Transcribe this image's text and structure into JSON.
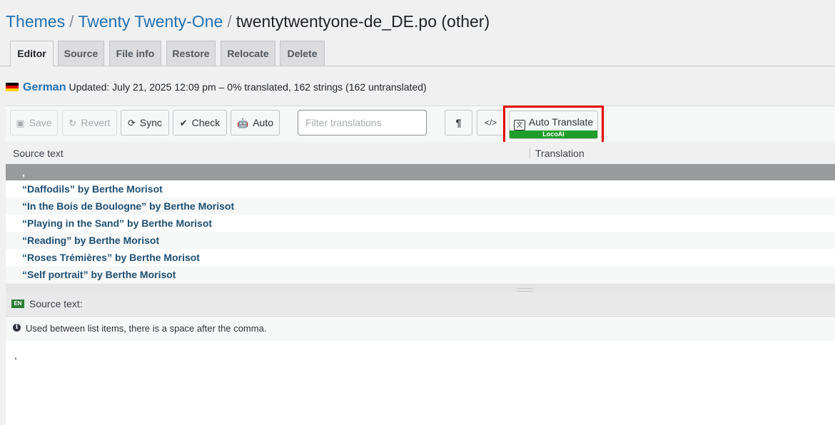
{
  "breadcrumb": {
    "themes": "Themes",
    "theme": "Twenty Twenty-One",
    "file": "twentytwentyone-de_DE.po (other)",
    "separator": "/"
  },
  "tabs": [
    "Editor",
    "Source",
    "File info",
    "Restore",
    "Relocate",
    "Delete"
  ],
  "language": {
    "name": "German",
    "status": "Updated: July 21, 2025 12:09 pm – 0% translated, 162 strings (162 untranslated)"
  },
  "toolbar": {
    "save": "Save",
    "revert": "Revert",
    "sync": "Sync",
    "check": "Check",
    "auto": "Auto",
    "filter_placeholder": "Filter translations",
    "pilcrow": "¶",
    "code": "</>",
    "auto_translate": "Auto Translate",
    "auto_translate_badge": "LocoAI"
  },
  "grid": {
    "col_source": "Source text",
    "col_translation": "Translation",
    "rows": [
      ",",
      "“Daffodils” by Berthe Morisot",
      "“In the Bois de Boulogne” by Berthe Morisot",
      "“Playing in the Sand” by Berthe Morisot",
      "“Reading” by Berthe Morisot",
      "“Roses Trémières” by Berthe Morisot",
      "“Self portrait” by Berthe Morisot"
    ]
  },
  "source_panel": {
    "lang_badge": "EN",
    "label": "Source text:",
    "note": "Used between list items, there is a space after the comma.",
    "value": ","
  },
  "colors": {
    "link": "#2271b1",
    "row_text": "#1e4f73",
    "selected_row": "#999a9c",
    "highlight_box": "#e50000",
    "badge_green": "#1f9d2a"
  }
}
